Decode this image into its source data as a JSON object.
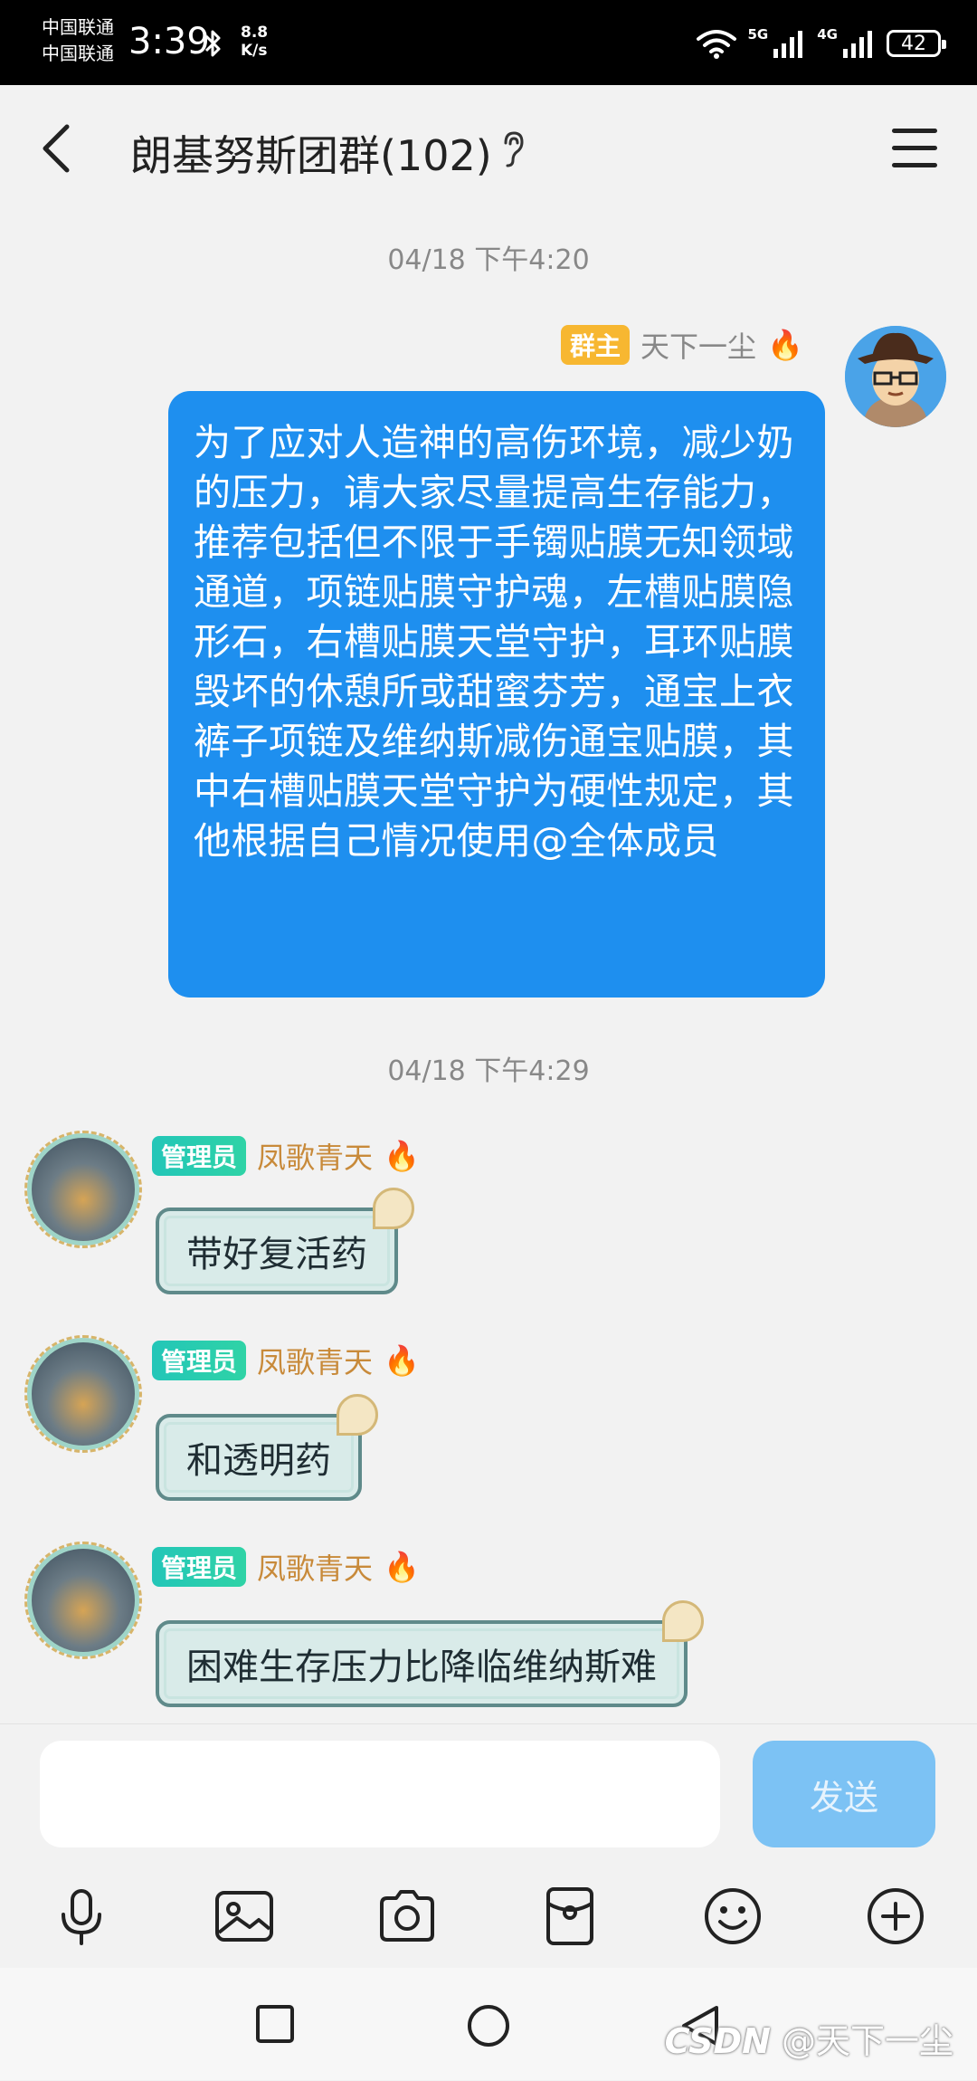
{
  "status_bar": {
    "carrier_1": "中国联通",
    "carrier_2": "中国联通",
    "time": "3:39",
    "speed_value": "8.8",
    "speed_unit": "K/s",
    "net_5g": "5G",
    "net_4g": "4G",
    "battery": "42"
  },
  "header": {
    "title": "朗基努斯团群(102)"
  },
  "messages": [
    {
      "timestamp": "04/18 下午4:20",
      "badge": "群主",
      "sender": "天下一尘",
      "text": "为了应对人造神的高伤环境，减少奶的压力，请大家尽量提高生存能力，推荐包括但不限于手镯贴膜无知领域通道，项链贴膜守护魂，左槽贴膜隐形石，右槽贴膜天堂守护，耳环贴膜毁坏的休憩所或甜蜜芬芳，通宝上衣裤子项链及维纳斯减伤通宝贴膜，其中右槽贴膜天堂守护为硬性规定，其他根据自己情况使用@全体成员"
    },
    {
      "timestamp": "04/18 下午4:29",
      "badge": "管理员",
      "sender": "凤歌青天",
      "text": "带好复活药"
    },
    {
      "badge": "管理员",
      "sender": "凤歌青天",
      "text": "和透明药"
    },
    {
      "badge": "管理员",
      "sender": "凤歌青天",
      "text": "困难生存压力比降临维纳斯难"
    }
  ],
  "input": {
    "value": "",
    "send_label": "发送"
  },
  "toolbar": [
    "microphone-icon",
    "image-icon",
    "camera-icon",
    "red-packet-icon",
    "emoji-icon",
    "plus-icon"
  ],
  "watermark": "@天下一尘",
  "watermark_logo": "CSDN",
  "colors": {
    "my_bubble": "#1e8fef",
    "owner_badge": "#f7b731",
    "admin_badge": "#23c6b8",
    "send_button": "#7cc2f4"
  }
}
